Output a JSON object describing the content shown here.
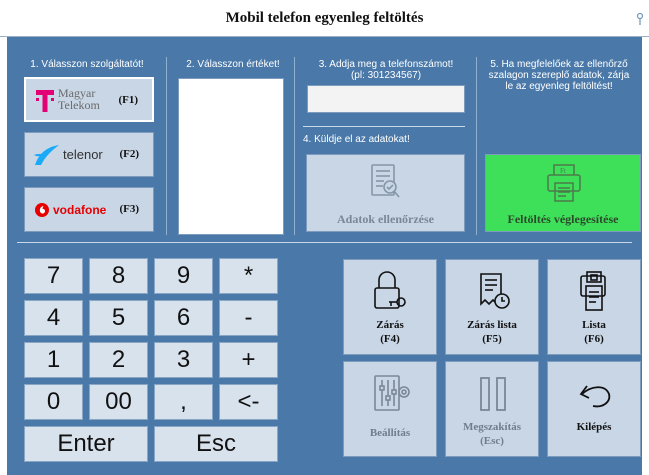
{
  "window": {
    "title": "Mobil telefon egyenleg feltöltés"
  },
  "steps": {
    "s1": "1. Válasszon szolgáltatót!",
    "s2": "2. Válasszon értéket!",
    "s3": "3. Addja meg a telefonszámot!",
    "s3_hint": "(pl: 301234567)",
    "s4": "4. Küldje el az adatokat!",
    "s5": "5. Ha megfelelőek az ellenőrző szalagon szereplő adatok, zárja le az egyenleg feltöltést!"
  },
  "providers": [
    {
      "brand_line1": "Magyar",
      "brand_line2": "Telekom",
      "hotkey": "(F1)"
    },
    {
      "brand": "telenor",
      "hotkey": "(F2)"
    },
    {
      "brand": "vodafone",
      "hotkey": "(F3)"
    }
  ],
  "phone_input": {
    "value": "",
    "placeholder": ""
  },
  "buttons": {
    "check": "Adatok ellenőrzése",
    "finalize": "Feltöltés véglegesítése"
  },
  "keypad": [
    "7",
    "8",
    "9",
    "*",
    "4",
    "5",
    "6",
    "-",
    "1",
    "2",
    "3",
    "+",
    "0",
    "00",
    ",",
    "<-"
  ],
  "keypad_enter": "Enter",
  "keypad_esc": "Esc",
  "actions": [
    {
      "icon": "lock-key-icon",
      "label1": "Zárás",
      "label2": "(F4)",
      "enabled": true
    },
    {
      "icon": "receipt-clock-icon",
      "label1": "Zárás lista",
      "label2": "(F5)",
      "enabled": true
    },
    {
      "icon": "printer-list-icon",
      "label1": "Lista",
      "label2": "(F6)",
      "enabled": true
    },
    {
      "icon": "settings-sliders-icon",
      "label1": "Beállítás",
      "label2": "",
      "enabled": false
    },
    {
      "icon": "pause-icon",
      "label1": "Megszakítás",
      "label2": "(Esc)",
      "enabled": false
    },
    {
      "icon": "undo-arrow-icon",
      "label1": "Kilépés",
      "label2": "",
      "enabled": true
    }
  ],
  "colors": {
    "panel": "#4a79a9",
    "button": "#c8d6e6",
    "finalize_green": "#3ee05a",
    "telekom_magenta": "#e20074",
    "telenor_blue": "#19aaf8",
    "vodafone_red": "#e60000"
  }
}
